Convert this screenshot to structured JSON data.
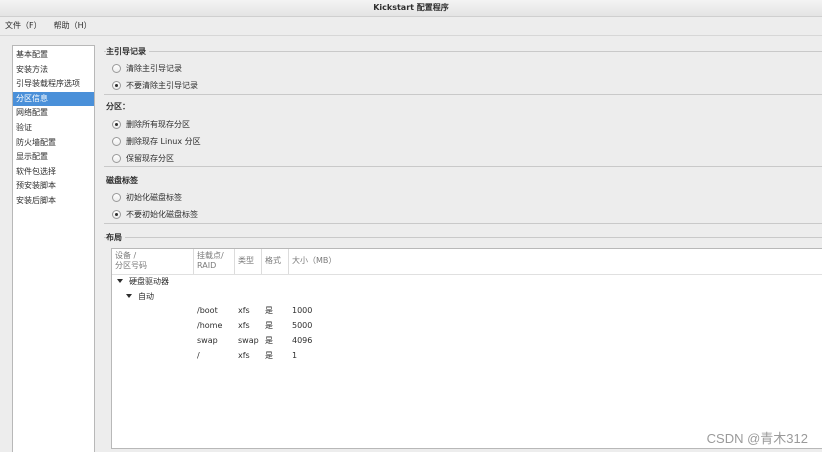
{
  "window": {
    "title": "Kickstart 配置程序"
  },
  "menu": [
    {
      "label": "文件（F）"
    },
    {
      "label": "帮助（H）"
    }
  ],
  "sidebar": {
    "items": [
      {
        "label": "基本配置"
      },
      {
        "label": "安装方法"
      },
      {
        "label": "引导装载程序选项"
      },
      {
        "label": "分区信息",
        "selected": true
      },
      {
        "label": "网络配置"
      },
      {
        "label": "验证"
      },
      {
        "label": "防火墙配置"
      },
      {
        "label": "显示配置"
      },
      {
        "label": "软件包选择"
      },
      {
        "label": "预安装脚本"
      },
      {
        "label": "安装后脚本"
      }
    ]
  },
  "mbr": {
    "title": "主引导记录",
    "options": [
      {
        "label": "清除主引导记录",
        "checked": false
      },
      {
        "label": "不要清除主引导记录",
        "checked": true
      }
    ]
  },
  "partitions": {
    "title": "分区：",
    "options": [
      {
        "label": "删除所有现存分区",
        "checked": true
      },
      {
        "label": "删除现存 Linux 分区",
        "checked": false
      },
      {
        "label": "保留现存分区",
        "checked": false
      }
    ]
  },
  "disklabel": {
    "title": "磁盘标签",
    "options": [
      {
        "label": "初始化磁盘标签",
        "checked": false
      },
      {
        "label": "不要初始化磁盘标签",
        "checked": true
      }
    ]
  },
  "layout": {
    "title": "布局",
    "columns": {
      "device_line1": "设备 /",
      "device_line2": "分区号码",
      "mount_line1": "挂载点/",
      "mount_line2": "RAID",
      "type": "类型",
      "format": "格式",
      "size": "大小（MB）"
    },
    "tree": {
      "drives": "硬盘驱动器",
      "auto": "自动"
    },
    "rows": [
      {
        "mount": "/boot",
        "type": "xfs",
        "format": "是",
        "size": "1000"
      },
      {
        "mount": "/home",
        "type": "xfs",
        "format": "是",
        "size": "5000"
      },
      {
        "mount": "swap",
        "type": "swap",
        "format": "是",
        "size": "4096"
      },
      {
        "mount": "/",
        "type": "xfs",
        "format": "是",
        "size": "1"
      }
    ]
  },
  "watermark": "CSDN @青木312"
}
